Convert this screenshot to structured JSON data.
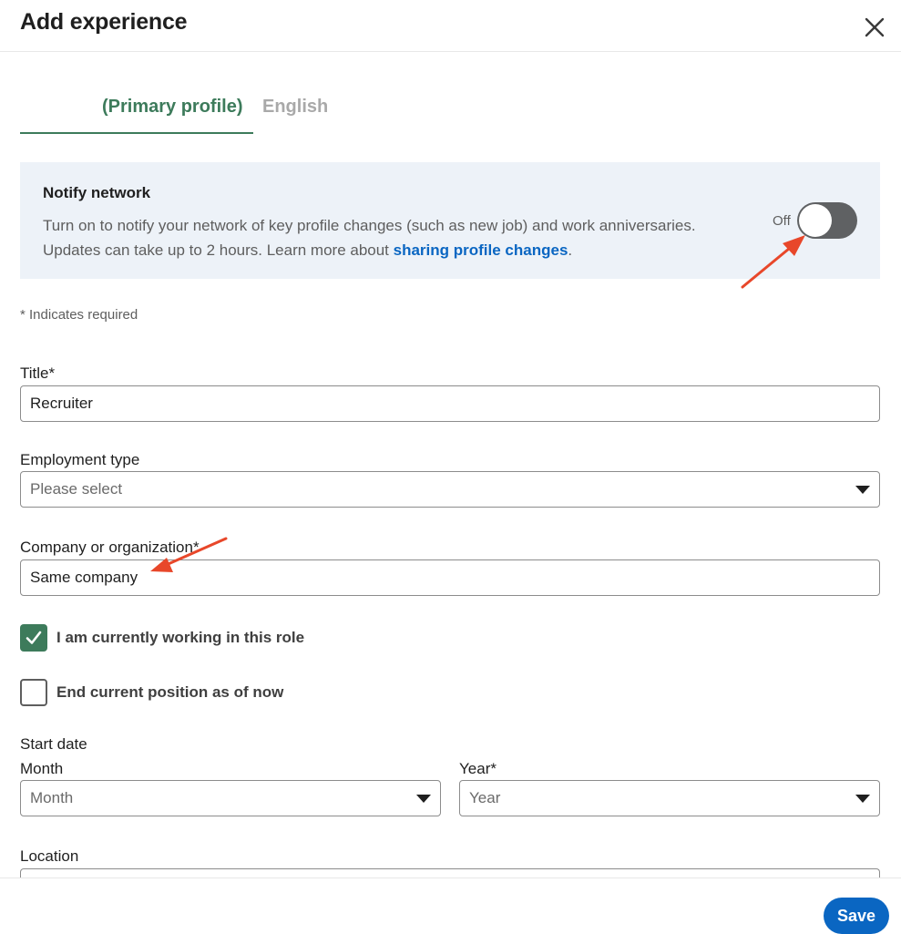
{
  "dialog": {
    "title": "Add experience",
    "close_icon": "close-icon"
  },
  "tabs": [
    {
      "label": "(Primary profile)",
      "active": true
    },
    {
      "label": "English",
      "active": false
    }
  ],
  "notify": {
    "title": "Notify network",
    "text_line1": "Turn on to notify your network of key profile changes (such as new job) and work anniversaries.",
    "text_line2_prefix": "Updates can take up to 2 hours. Learn more about ",
    "link": "sharing profile changes",
    "text_line2_suffix": ".",
    "toggle_label": "Off",
    "toggle_on": false
  },
  "form": {
    "required_note": "* Indicates required",
    "title_label": "Title*",
    "title_value": "Recruiter",
    "employment_label": "Employment type",
    "employment_value": "Please select",
    "company_label": "Company or organization*",
    "company_value": "Same company",
    "currently_working_label": "I am currently working in this role",
    "currently_working_checked": true,
    "end_position_label": "End current position as of now",
    "end_position_checked": false,
    "start_date_label": "Start date",
    "month_label": "Month",
    "month_value": "Month",
    "year_label": "Year*",
    "year_value": "Year",
    "location_label": "Location"
  },
  "footer": {
    "save_label": "Save"
  },
  "colors": {
    "accent_green": "#3d7b5b",
    "link_blue": "#0a66c2",
    "banner_bg": "#edf2f8",
    "annotation_arrow": "#e8472a"
  }
}
